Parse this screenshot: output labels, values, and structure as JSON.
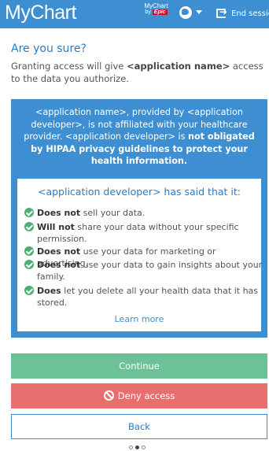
{
  "header": {
    "logo": "MyChart",
    "badge_line1": "MyChart",
    "badge_by": "by",
    "badge_epic": "Epic",
    "end_session_label": "End session"
  },
  "dialog": {
    "title": "Are you sure?",
    "intro_prefix": "Granting access will give ",
    "intro_app": "<application name>",
    "intro_suffix": " access to the data you authorize."
  },
  "warning": {
    "part1": "<application name>, provided by <application developer>, is not affiliated with your healthcare provider. <application developer> is ",
    "part2_bold": "not obligated by HIPAA privacy guidelines to protect your health information."
  },
  "card": {
    "title": "<application developer> has said that it:",
    "items": [
      {
        "bold": "Does not",
        "text": " sell your data."
      },
      {
        "bold": "Will not",
        "text": " share your data without your specific permission."
      },
      {
        "bold": "Does not",
        "text": " use your data for marketing or advertising."
      },
      {
        "bold": "Does not",
        "text": " use your data to gain insights about your family."
      },
      {
        "bold": "Does",
        "text": " let you delete all your health data that it has stored."
      }
    ],
    "learn_more": "Learn more"
  },
  "buttons": {
    "continue": "Continue",
    "deny": "Deny access",
    "back": "Back"
  },
  "pagination": {
    "current": 2,
    "total": 3
  },
  "colors": {
    "header": "#3d8fd1",
    "accent": "#2b7bc4",
    "continue": "#6cc197",
    "deny": "#e96e6e",
    "check": "#4cae73"
  }
}
